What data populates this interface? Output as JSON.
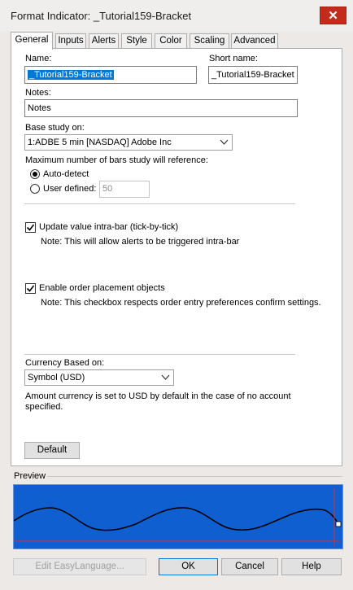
{
  "window": {
    "title": "Format Indicator: _Tutorial159-Bracket",
    "close_glyph": "✕"
  },
  "tabs": [
    {
      "label": "General",
      "active": true
    },
    {
      "label": "Inputs"
    },
    {
      "label": "Alerts"
    },
    {
      "label": "Style"
    },
    {
      "label": "Color"
    },
    {
      "label": "Scaling"
    },
    {
      "label": "Advanced"
    }
  ],
  "general": {
    "name_label": "Name:",
    "name_value": "_Tutorial159-Bracket",
    "short_name_label": "Short name:",
    "short_name_value": "_Tutorial159-Bracket",
    "notes_label": "Notes:",
    "notes_value": "Notes",
    "base_study_label": "Base study on:",
    "base_study_value": "1:ADBE 5 min [NASDAQ] Adobe Inc",
    "max_bars_label": "Maximum number of bars study will reference:",
    "auto_detect_label": "Auto-detect",
    "auto_detect_selected": true,
    "user_defined_label": "User defined:",
    "user_defined_value": "50",
    "update_intrabar_label": "Update value intra-bar (tick-by-tick)",
    "update_intrabar_checked": true,
    "update_intrabar_note": "Note: This will allow alerts to be triggered intra-bar",
    "order_objects_label": "Enable order placement objects",
    "order_objects_checked": true,
    "order_objects_note": "Note: This checkbox respects order entry preferences confirm settings.",
    "currency_label": "Currency Based on:",
    "currency_value": "Symbol (USD)",
    "currency_note_line1": "Amount currency is set to USD by default in the case of no account",
    "currency_note_line2": "specified.",
    "default_button": "Default"
  },
  "preview": {
    "label": "Preview",
    "background": "#0f5fd1",
    "line_color": "#000000",
    "baseline_color": "#d9302c"
  },
  "footer": {
    "edit_easylanguage": "Edit EasyLanguage...",
    "ok": "OK",
    "cancel": "Cancel",
    "help": "Help"
  }
}
